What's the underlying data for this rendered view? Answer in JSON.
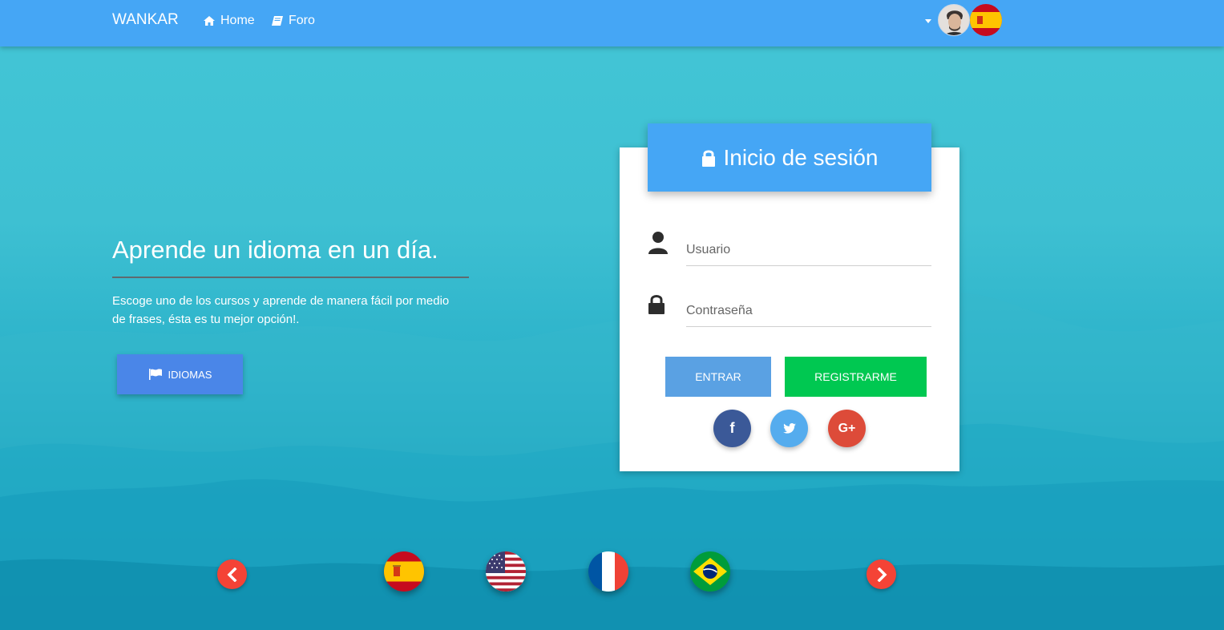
{
  "navbar": {
    "brand": "WANKAR",
    "links": [
      {
        "label": "Home",
        "icon": "home-icon"
      },
      {
        "label": "Foro",
        "icon": "book-icon"
      }
    ],
    "user_menu_icon": "caret-down-icon",
    "language_flag": "spain-flag"
  },
  "hero": {
    "title": "Aprende un idioma en un día.",
    "description": "Escoge uno de los cursos y aprende de manera fácil por medio de frases, ésta es tu mejor opción!.",
    "button_label": "IDIOMAS",
    "button_icon": "flag-icon"
  },
  "login": {
    "title": "Inicio de sesión",
    "title_icon": "lock-icon",
    "username_placeholder": "Usuario",
    "password_placeholder": "Contraseña",
    "enter_label": "ENTRAR",
    "register_label": "REGISTRARME",
    "social": [
      {
        "name": "facebook",
        "glyph": "f"
      },
      {
        "name": "twitter",
        "glyph": ""
      },
      {
        "name": "google-plus",
        "glyph": "G+"
      }
    ]
  },
  "carousel": {
    "flags": [
      "spain",
      "usa",
      "france",
      "brazil"
    ]
  },
  "colors": {
    "navbar": "#45a6f5",
    "primary_button": "#4a86e8",
    "enter_button": "#5aa1e3",
    "register_button": "#00c851",
    "facebook": "#3b5998",
    "twitter": "#55acee",
    "google_plus": "#dd4b39",
    "carousel_arrow": "#f44336"
  }
}
